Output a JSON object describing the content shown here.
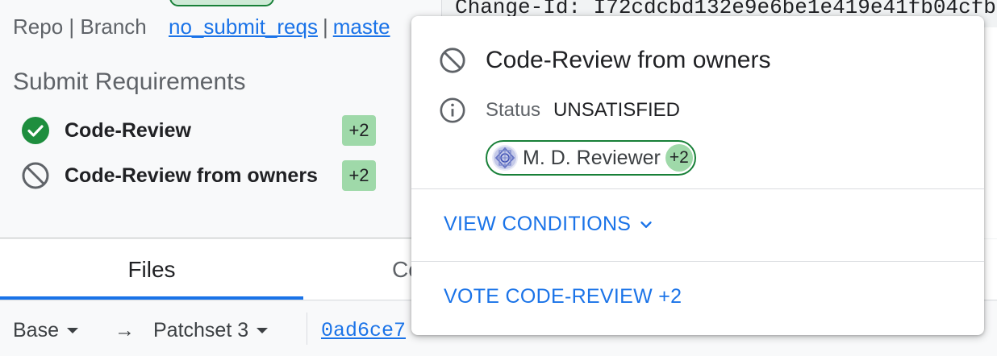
{
  "change_info": {
    "repo_branch_label": "Repo | Branch",
    "repo": "no_submit_reqs",
    "separator": "|",
    "branch": "maste",
    "change_id_text": "Change-Id: I72cdcbd132e9e6be1e419e41fb04cfb"
  },
  "submit_requirements": {
    "title": "Submit Requirements",
    "items": [
      {
        "name": "Code-Review",
        "vote": "+2",
        "status": "satisfied"
      },
      {
        "name": "Code-Review from owners",
        "vote": "+2",
        "status": "unsatisfied"
      }
    ]
  },
  "tabs": {
    "files": "Files",
    "comments_partial": "Co"
  },
  "file_bar": {
    "base": "Base",
    "arrow": "→",
    "patchset": "Patchset 3",
    "commit_sha": "0ad6ce7"
  },
  "popup": {
    "title": "Code-Review from owners",
    "status_label": "Status",
    "status_value": "UNSATISFIED",
    "reviewer": {
      "name": "M. D. Reviewer",
      "vote": "+2"
    },
    "view_conditions": "VIEW CONDITIONS",
    "vote_action": "VOTE CODE-REVIEW +2"
  },
  "colors": {
    "link": "#1a73e8",
    "vote_positive": "#9fd9a9",
    "satisfied_green": "#1e8e3e",
    "chip_border": "#188038"
  },
  "icons": {
    "satisfied": "check-circle-icon",
    "unsatisfied": "block-icon",
    "status": "info-icon",
    "expand": "chevron-down-icon"
  }
}
